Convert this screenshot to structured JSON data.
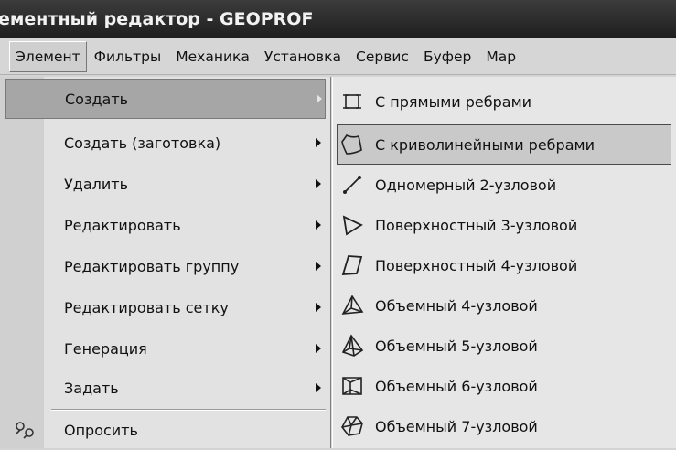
{
  "window": {
    "title": "ементный редактор - GEOPROF"
  },
  "menubar": {
    "items": [
      "Элемент",
      "Фильтры",
      "Механика",
      "Установка",
      "Сервис",
      "Буфер",
      "Мар"
    ]
  },
  "element_menu": {
    "items": [
      {
        "label": "Создать",
        "submenu": true
      },
      {
        "label": "Создать (заготовка)",
        "submenu": true
      },
      {
        "label": "Удалить",
        "submenu": true
      },
      {
        "label": "Редактировать",
        "submenu": true
      },
      {
        "label": "Редактировать группу",
        "submenu": true
      },
      {
        "label": "Редактировать сетку",
        "submenu": true
      },
      {
        "label": "Генерация",
        "submenu": true
      },
      {
        "label": "Задать",
        "submenu": true
      },
      {
        "label": "Опросить",
        "icon": "query-icon"
      }
    ]
  },
  "create_submenu": {
    "items": [
      {
        "label": "С прямыми ребрами",
        "icon": "straight-edge-element-icon"
      },
      {
        "label": "С криволинейными ребрами",
        "icon": "curved-edge-element-icon"
      },
      {
        "label": "Одномерный 2-узловой",
        "icon": "line-element-icon"
      },
      {
        "label": "Поверхностный 3-узловой",
        "icon": "triangle-element-icon"
      },
      {
        "label": "Поверхностный 4-узловой",
        "icon": "quad-element-icon"
      },
      {
        "label": "Объемный 4-узловой",
        "icon": "tetra-element-icon"
      },
      {
        "label": "Объемный 5-узловой",
        "icon": "pyramid-element-icon"
      },
      {
        "label": "Объемный 6-узловой",
        "icon": "wedge-element-icon"
      },
      {
        "label": "Объемный 7-узловой",
        "icon": "solid7-element-icon"
      }
    ]
  }
}
